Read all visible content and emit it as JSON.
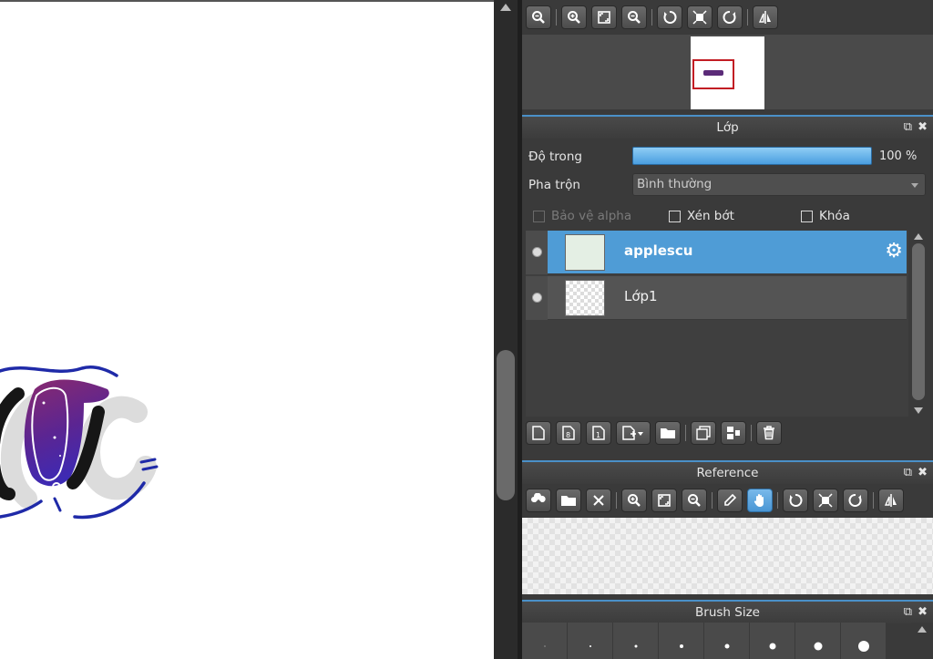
{
  "navigator": {
    "toolbar": [
      {
        "name": "zoom-reset-icon"
      },
      {
        "name": "zoom-in-icon"
      },
      {
        "name": "fit-screen-icon"
      },
      {
        "name": "zoom-out-icon"
      },
      {
        "name": "rotate-left-icon"
      },
      {
        "name": "rotate-reset-icon"
      },
      {
        "name": "rotate-right-icon"
      },
      {
        "name": "flip-horizontal-icon"
      }
    ]
  },
  "layers": {
    "title": "Lớp",
    "opacity_label": "Độ trong",
    "opacity_value": "100 %",
    "opacity_fraction": 1.0,
    "blend_label": "Pha trộn",
    "blend_value": "Bình thường",
    "protect_alpha": "Bảo vệ alpha",
    "clipping": "Xén bớt",
    "lock": "Khóa",
    "items": [
      {
        "name": "applescu",
        "selected": true
      },
      {
        "name": "Lớp1",
        "selected": false
      }
    ],
    "toolbar": [
      {
        "name": "new-layer-icon"
      },
      {
        "name": "new-8bit-layer-icon"
      },
      {
        "name": "new-1bit-layer-icon"
      },
      {
        "name": "add-layer-dropdown-icon"
      },
      {
        "name": "folder-icon"
      },
      {
        "name": "duplicate-layer-icon"
      },
      {
        "name": "merge-layer-icon"
      },
      {
        "name": "delete-layer-icon"
      }
    ]
  },
  "reference": {
    "title": "Reference",
    "toolbar": [
      {
        "name": "upload-cloud-icon"
      },
      {
        "name": "open-folder-icon"
      },
      {
        "name": "close-icon"
      },
      {
        "name": "zoom-in-icon"
      },
      {
        "name": "fit-screen-icon"
      },
      {
        "name": "zoom-out-icon"
      },
      {
        "name": "eyedropper-icon"
      },
      {
        "name": "hand-icon"
      },
      {
        "name": "rotate-left-icon"
      },
      {
        "name": "rotate-reset-icon"
      },
      {
        "name": "rotate-right-icon"
      },
      {
        "name": "flip-horizontal-icon"
      }
    ]
  },
  "brush_size": {
    "title": "Brush Size",
    "sizes": [
      1,
      2,
      3,
      4,
      5,
      7,
      9,
      12
    ]
  },
  "colors": {
    "accent": "#4f9cd6",
    "panel_bg": "#3a3a3a",
    "header_line": "#4a90c8",
    "canvas_bg": "#ffffff"
  }
}
